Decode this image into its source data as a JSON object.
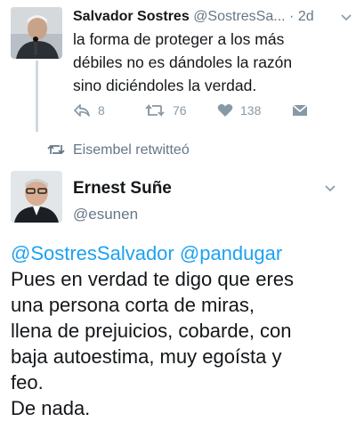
{
  "tweet1": {
    "name": "Salvador Sostres",
    "handle": "@SostresSa...",
    "dot": "·",
    "time": "2d",
    "text_lines": [
      "la forma de proteger a los más",
      "débiles no es dándoles la razón",
      "sino diciéndoles la verdad."
    ],
    "actions": {
      "reply_icon": "reply-icon",
      "reply_count": "8",
      "retweet_icon": "retweet-icon",
      "retweet_count": "76",
      "like_icon": "heart-icon",
      "like_count": "138",
      "dm_icon": "envelope-icon"
    }
  },
  "retweet_context": {
    "icon": "retweet-icon",
    "text": "Eisembel retwitteó"
  },
  "tweet2": {
    "name": "Ernest Suñe",
    "handle": "@esunen",
    "mentions": [
      "@SostresSalvador",
      "@pandugar"
    ],
    "body_lines": [
      "Pues en verdad te digo que eres",
      "una persona corta de miras,",
      "llena de prejuicios, cobarde, con",
      "baja autoestima, muy egoísta y",
      "feo.",
      "De nada."
    ]
  },
  "colors": {
    "text": "#14171a",
    "secondary": "#657786",
    "icon": "#8899a6",
    "link": "#1da1f2",
    "thread_line": "#cfd9de"
  }
}
